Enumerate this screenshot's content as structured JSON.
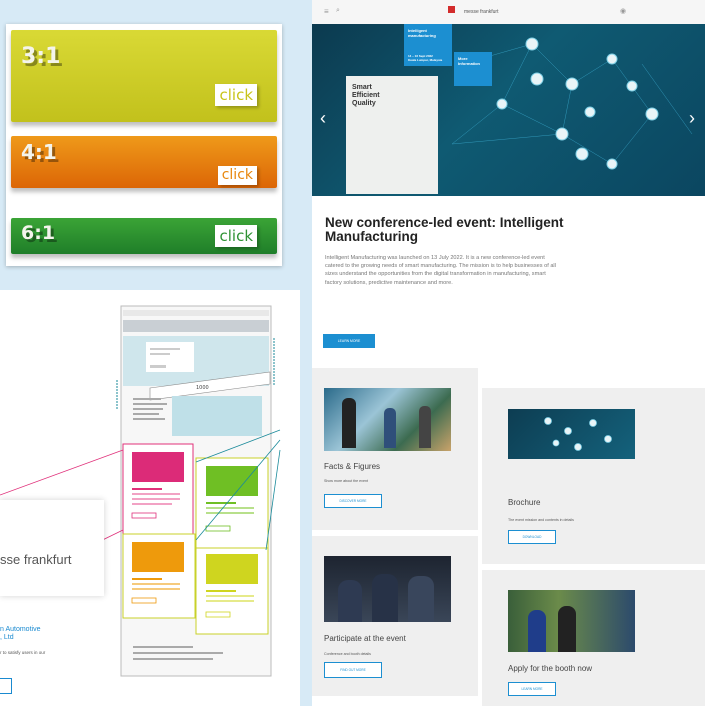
{
  "swatches": {
    "items": [
      {
        "ratio": "3:1",
        "button": "click",
        "color_top": "#d8d832",
        "color_bottom": "#c3c21e"
      },
      {
        "ratio": "4:1",
        "button": "click",
        "color_top": "#ee9418",
        "color_bottom": "#dd6a07"
      },
      {
        "ratio": "6:1",
        "button": "click",
        "color_top": "#3aa034",
        "color_bottom": "#20802a"
      }
    ]
  },
  "wireframe": {
    "card_text": "sse frankfurt",
    "link_text": "n Automotive\n, Ltd",
    "small_text": "r to satisfy users in our",
    "accent_pink": "#e0307a",
    "accent_orange": "#ee9a0c",
    "accent_green": "#6fbf24",
    "accent_yellow": "#cfd51f"
  },
  "site": {
    "brand": "messe frankfurt",
    "hero": {
      "tile_text": "Smart\nEfficient\nQuality",
      "box1_title": "Intelligent manufacturing",
      "box1_detail": "14 – 16 Sept 2022\nKuala Lumpur, Malaysia",
      "box2_title": "More Information"
    },
    "headline": "New conference-led event: Intelligent Manufacturing",
    "paragraph": "Intelligent Manufacturing was launched on 13 July 2022. It is a new conference-led event catered to the growing needs of smart manufacturing. The mission is to help businesses of all sizes understand the opportunities from the digital transformation in manufacturing, smart factory solutions, predictive maintenance and more.",
    "learn_more": "LEARN MORE",
    "cards": {
      "facts": {
        "title": "Facts & Figures",
        "sub": "Show more about the event",
        "button": "DISCOVER MORE"
      },
      "brochure": {
        "title": "Brochure",
        "sub": "The event mission and contents in details",
        "button": "DOWNLOAD"
      },
      "participate": {
        "title": "Participate at the event",
        "sub": "Conference and booth details",
        "button": "FIND OUT MORE"
      },
      "booth": {
        "title": "Apply for the booth now",
        "button": "LEARN MORE"
      }
    }
  }
}
